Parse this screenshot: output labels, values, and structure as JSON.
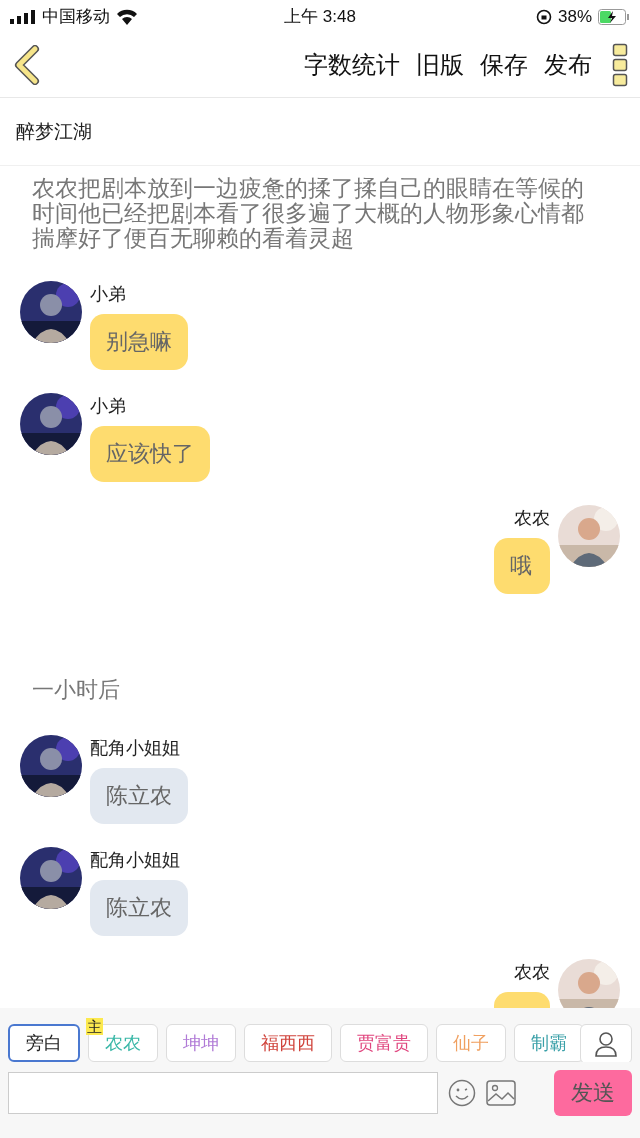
{
  "status_bar": {
    "carrier": "中国移动",
    "time": "上午 3:48",
    "battery": "38%"
  },
  "nav": {
    "actions": [
      "字数统计",
      "旧版",
      "保存",
      "发布"
    ]
  },
  "story_title": "醉梦江湖",
  "messages": [
    {
      "kind": "narration",
      "text": "农农把剧本放到一边疲惫的揉了揉自己的眼睛在等候的时间他已经把剧本看了很多遍了大概的人物形象心情都揣摩好了便百无聊赖的看着灵超"
    },
    {
      "kind": "left",
      "name": "小弟",
      "text": "别急嘛",
      "color": "#fedc6f"
    },
    {
      "kind": "left",
      "name": "小弟",
      "text": "应该快了",
      "color": "#fedc6f"
    },
    {
      "kind": "right",
      "name": "农农",
      "text": "哦",
      "color": "#fedc6f"
    },
    {
      "kind": "note",
      "text": "一小时后"
    },
    {
      "kind": "left",
      "name": "配角小姐姐",
      "text": "陈立农",
      "color": "#e2e8f0"
    },
    {
      "kind": "left",
      "name": "配角小姐姐",
      "text": "陈立农",
      "color": "#e2e8f0"
    },
    {
      "kind": "right",
      "name": "农农",
      "color": "#fedc6f"
    }
  ],
  "roles": [
    {
      "label": "旁白",
      "selected": true,
      "color": "#222222"
    },
    {
      "label": "农农",
      "selected": false,
      "color": "#3bb8a8",
      "badge": "主"
    },
    {
      "label": "坤坤",
      "selected": false,
      "color": "#b07ad6"
    },
    {
      "label": "福西西",
      "selected": false,
      "color": "#d0443c"
    },
    {
      "label": "贾富贵",
      "selected": false,
      "color": "#e0457e"
    },
    {
      "label": "仙子",
      "selected": false,
      "color": "#f0a060"
    },
    {
      "label": "制霸",
      "selected": false,
      "color": "#3aa0a8"
    }
  ],
  "composer": {
    "send": "发送"
  }
}
